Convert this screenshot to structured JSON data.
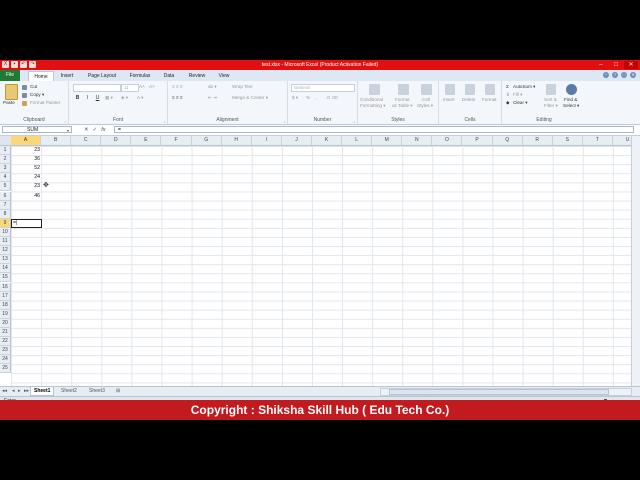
{
  "window": {
    "title": "test.xlsx - Microsoft Excel (Product Activation Failed)",
    "controls": [
      "–",
      "□",
      "✕"
    ]
  },
  "tabs": [
    "File",
    "Home",
    "Insert",
    "Page Layout",
    "Formulas",
    "Data",
    "Review",
    "View"
  ],
  "ribbon": {
    "clipboard": {
      "label": "Clipboard",
      "paste": "Paste",
      "cut": "Cut",
      "copy": "Copy ▾",
      "format_painter": "Format Painter"
    },
    "font": {
      "label": "Font",
      "font_size": "11",
      "bold": "B",
      "italic": "I",
      "underline": "U"
    },
    "alignment": {
      "label": "Alignment",
      "wrap_text": "Wrap Text",
      "merge_center": "Merge & Center ▾"
    },
    "number": {
      "label": "Number",
      "format": "General",
      "percent": "%"
    },
    "styles": {
      "label": "Styles",
      "conditional": [
        "Conditional",
        "Formatting ▾"
      ],
      "format_table": [
        "Format",
        "as Table ▾"
      ],
      "cell_styles": [
        "Cell",
        "Styles ▾"
      ]
    },
    "cells": {
      "label": "Cells",
      "insert": "Insert",
      "delete": "Delete",
      "format": "Format"
    },
    "editing": {
      "label": "Editing",
      "autosum": "AutoSum ▾",
      "fill": "Fill ▾",
      "clear": "Clear ▾",
      "sort_filter": [
        "Sort &",
        "Filter ▾"
      ],
      "find_select": [
        "Find &",
        "Select ▾"
      ]
    }
  },
  "formula_bar": {
    "name_box": "SUM",
    "icons": [
      "▾",
      "✕",
      "✓",
      "fx"
    ],
    "content": "="
  },
  "columns": [
    "A",
    "B",
    "C",
    "D",
    "E",
    "F",
    "G",
    "H",
    "I",
    "J",
    "K",
    "L",
    "M",
    "N",
    "O",
    "P",
    "Q",
    "R",
    "S",
    "T",
    "U"
  ],
  "rows": [
    "1",
    "2",
    "3",
    "4",
    "5",
    "6",
    "7",
    "8",
    "9",
    "10",
    "11",
    "12",
    "13",
    "14",
    "15",
    "16",
    "17",
    "18",
    "19",
    "20",
    "21",
    "22",
    "23",
    "24",
    "25"
  ],
  "cells": {
    "A1": "23",
    "A2": "36",
    "A3": "52",
    "A4": "24",
    "A5": "23",
    "A6": "46"
  },
  "active_cell": {
    "ref": "A9",
    "text": "=|"
  },
  "sheets": [
    "Sheet1",
    "Sheet2",
    "Sheet3"
  ],
  "status": {
    "mode": "Enter",
    "zoom": "100%"
  },
  "copyright": "Copyright : Shiksha Skill Hub ( Edu Tech Co.)",
  "colors": {
    "title_bar": "#e01010",
    "file_tab": "#1f7a34",
    "selection_header": "#fbd779",
    "banner": "#c11a1f"
  }
}
